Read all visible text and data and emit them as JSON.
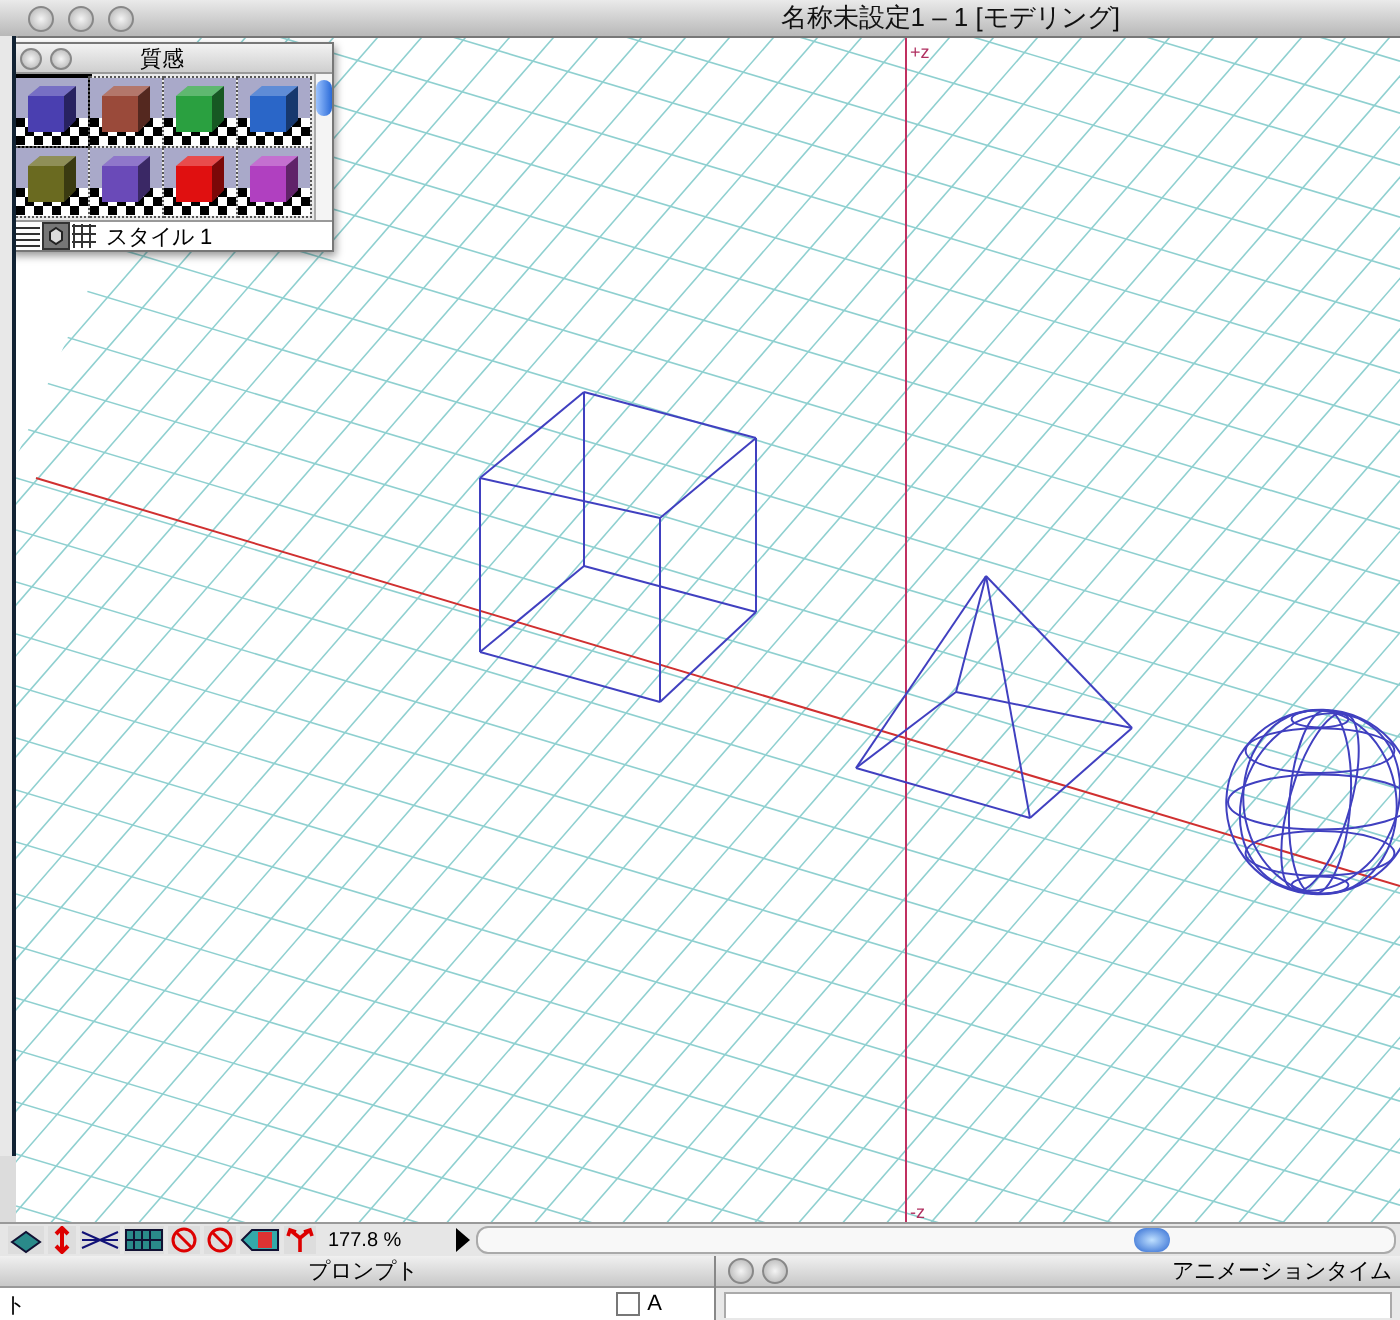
{
  "window": {
    "title": "名称未設定1 – 1 [モデリング]"
  },
  "material_palette": {
    "title": "質感",
    "style_label": "スタイル 1",
    "swatches": [
      {
        "color": "#4a3fb0",
        "selected": true
      },
      {
        "color": "#9a4a3a",
        "selected": false
      },
      {
        "color": "#2aa040",
        "selected": false
      },
      {
        "color": "#2a66c8",
        "selected": false
      },
      {
        "color": "#6a6a20",
        "selected": false
      },
      {
        "color": "#6a4ab8",
        "selected": false
      },
      {
        "color": "#e01010",
        "selected": false
      },
      {
        "color": "#b040c0",
        "selected": false
      }
    ]
  },
  "viewport": {
    "axis_labels": [
      {
        "kind": "top",
        "text": "+z"
      },
      {
        "kind": "bottom",
        "text": "-z"
      }
    ]
  },
  "toolbar": {
    "zoom": "177.8 %"
  },
  "prompt_panel": {
    "title": "プロンプト",
    "text": "ト",
    "checkbox": {
      "label": "A",
      "checked": false
    }
  },
  "animation_panel": {
    "title": "アニメーションタイム"
  }
}
